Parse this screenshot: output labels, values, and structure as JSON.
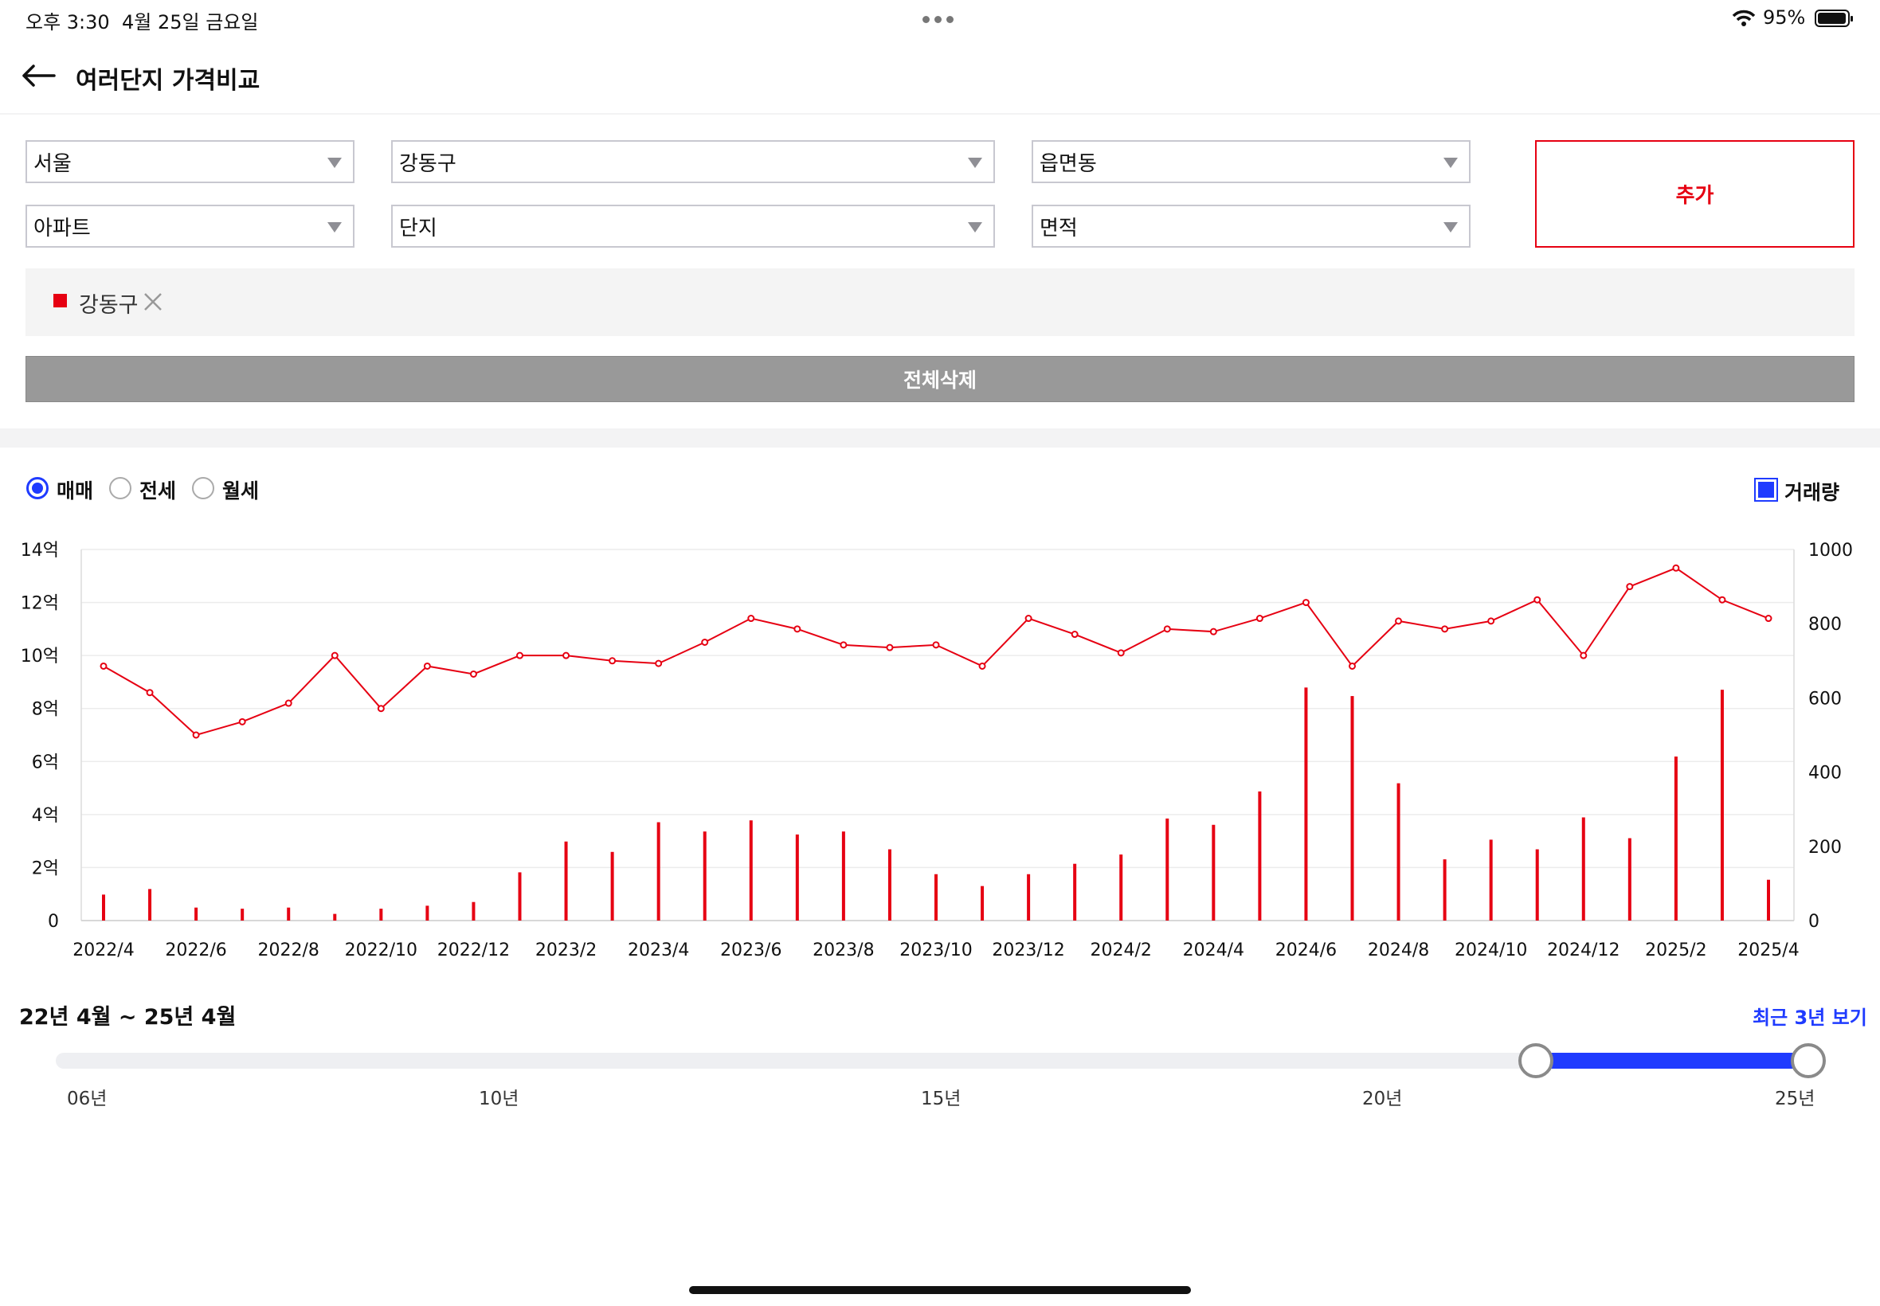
{
  "status_bar": {
    "time": "오후 3:30",
    "date": "4월 25일 금요일",
    "battery": "95%"
  },
  "header": {
    "title": "여러단지 가격비교"
  },
  "filters": {
    "city": "서울",
    "district": "강동구",
    "dong": "읍면동",
    "property_type": "아파트",
    "complex": "단지",
    "area": "면적",
    "add_label": "추가"
  },
  "selected_chip": {
    "label": "강동구",
    "color": "#e60012"
  },
  "clear_all_label": "전체삭제",
  "trade_types": [
    {
      "label": "매매",
      "selected": true
    },
    {
      "label": "전세",
      "selected": false
    },
    {
      "label": "월세",
      "selected": false
    }
  ],
  "volume_toggle": {
    "label": "거래량",
    "checked": true
  },
  "chart_data": {
    "type": "line",
    "x": [
      "2022/4",
      "2022/5",
      "2022/6",
      "2022/7",
      "2022/8",
      "2022/9",
      "2022/10",
      "2022/11",
      "2022/12",
      "2023/1",
      "2023/2",
      "2023/3",
      "2023/4",
      "2023/5",
      "2023/6",
      "2023/7",
      "2023/8",
      "2023/9",
      "2023/10",
      "2023/11",
      "2023/12",
      "2024/1",
      "2024/2",
      "2024/3",
      "2024/4",
      "2024/5",
      "2024/6",
      "2024/7",
      "2024/8",
      "2024/9",
      "2024/10",
      "2024/11",
      "2024/12",
      "2025/1",
      "2025/2",
      "2025/3",
      "2025/4"
    ],
    "x_tick_labels": [
      "2022/4",
      "2022/6",
      "2022/8",
      "2022/10",
      "2022/12",
      "2023/2",
      "2023/4",
      "2023/6",
      "2023/8",
      "2023/10",
      "2023/12",
      "2024/2",
      "2024/4",
      "2024/6",
      "2024/8",
      "2024/10",
      "2024/12",
      "2025/2",
      "2025/4"
    ],
    "y_left_ticks": [
      "0",
      "2억",
      "4억",
      "6억",
      "8억",
      "10억",
      "12억",
      "14억"
    ],
    "y_left_range": [
      0,
      14
    ],
    "y_right_ticks": [
      "0",
      "200",
      "400",
      "600",
      "800",
      "1000"
    ],
    "y_right_range": [
      0,
      1000
    ],
    "grid": true,
    "color": "#e60012",
    "series": [
      {
        "kind": "line",
        "axis": "left",
        "unit": "억",
        "values": [
          9.6,
          8.6,
          7.0,
          7.5,
          8.2,
          10.0,
          8.0,
          9.6,
          9.3,
          10.0,
          10.0,
          9.8,
          9.7,
          10.5,
          11.4,
          11.0,
          10.4,
          10.3,
          10.4,
          9.6,
          11.4,
          10.8,
          10.1,
          11.0,
          10.9,
          11.4,
          12.0,
          9.6,
          11.3,
          11.0,
          11.3,
          12.1,
          10.0,
          12.6,
          13.3,
          12.1,
          11.4
        ]
      },
      {
        "kind": "bar",
        "axis": "right",
        "values": [
          70,
          85,
          35,
          32,
          35,
          18,
          32,
          40,
          50,
          130,
          213,
          185,
          265,
          240,
          270,
          232,
          240,
          192,
          125,
          93,
          125,
          153,
          178,
          275,
          258,
          348,
          628,
          605,
          370,
          165,
          218,
          192,
          278,
          222,
          442,
          622,
          110
        ]
      }
    ]
  },
  "period": {
    "range_label": "22년 4월 ~ 25년 4월",
    "recent_link": "최근 3년 보기",
    "slider_ticks": [
      "06년",
      "10년",
      "15년",
      "20년",
      "25년"
    ],
    "slider_min_year": 2006,
    "slider_max_year": 2025.3,
    "selected_start_year": 2022.3,
    "selected_end_year": 2025.3
  }
}
